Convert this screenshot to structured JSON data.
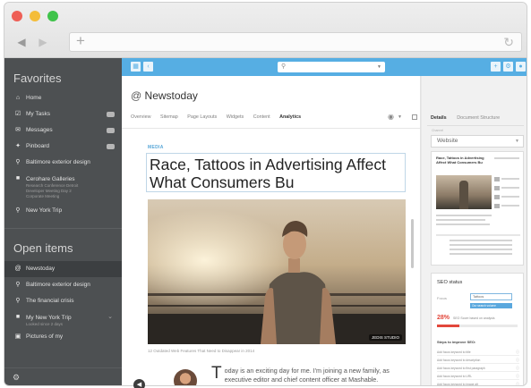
{
  "window": {
    "address_value": "",
    "colors": {
      "close": "#ee5f56",
      "minimize": "#f4bd3a",
      "maximize": "#3fc34a"
    },
    "icons": {
      "back": "arrow-left-icon",
      "forward": "arrow-right-icon",
      "new_tab": "plus-icon",
      "reload": "reload-icon"
    }
  },
  "sidebar": {
    "favorites_title": "Favorites",
    "favorites": [
      {
        "label": "Home",
        "icon": "home-icon",
        "badge": false
      },
      {
        "label": "My Tasks",
        "icon": "tasks-icon",
        "badge": true
      },
      {
        "label": "Messages",
        "icon": "messages-icon",
        "badge": true
      },
      {
        "label": "Pinboard",
        "icon": "pin-icon",
        "badge": true
      },
      {
        "label": "Baltimore exterior design",
        "icon": "search-icon",
        "badge": false
      },
      {
        "label": "Cerohare Galleries",
        "icon": "document-icon",
        "subtext": [
          "Research Conference Detroit",
          "Developer Meeting Day 2",
          "Corporate Meeting"
        ]
      },
      {
        "label": "New York Trip",
        "icon": "search-icon",
        "badge": false
      }
    ],
    "open_items_title": "Open items",
    "open_items": [
      {
        "label": "Newstoday",
        "icon": "at-icon",
        "active": true
      },
      {
        "label": "Baltimore exterior design",
        "icon": "search-icon"
      },
      {
        "label": "The financial crisis",
        "icon": "search-icon"
      },
      {
        "label": "My New York Trip",
        "icon": "document-icon",
        "subtext": [
          "Looked since 2 days"
        ],
        "chevron": true
      },
      {
        "label": "Pictures of my",
        "icon": "image-icon"
      }
    ],
    "footer_icon": "settings-icon",
    "colors": {
      "background": "#4d5052",
      "active": "#3c3f41"
    }
  },
  "appbar": {
    "search_value": "",
    "accent": "#56aee3",
    "left_icons": [
      "layout-icon",
      "back-icon"
    ],
    "right_icons": [
      "add-icon",
      "settings-icon",
      "user-icon"
    ]
  },
  "main": {
    "title_prefix": "@",
    "title": "Newstoday",
    "tabs": [
      "Overview",
      "Sitemap",
      "Page Layouts",
      "Widgets",
      "Content",
      "Analytics"
    ],
    "active_tab": "Analytics",
    "section_label": "MEDIA",
    "headline": "Race, Tattoos in Advertising Affect What Consumers Bu",
    "hero_credit": "JEDIS STUDIO",
    "caption": "12 Outdated Web Features That Need to Disappear in 2014",
    "body_dropcap": "T",
    "body_text": "oday is an exciting day for me. I'm joining a new family, as executive editor and chief content officer at Mashable."
  },
  "right_panel": {
    "tabs": [
      "Details",
      "Document Structure"
    ],
    "active_tab": "Details",
    "channel_label": "Channel",
    "channel_value": "Website",
    "preview_title": "Race, Tattoos in Advertising Affect What Consumers Bu",
    "seo": {
      "title": "SEO status",
      "focus_label": "Focus",
      "focus_value": "Tattoos",
      "focus_chip": "Our search volume",
      "score": "28%",
      "score_text": "SEO Score based on analysis",
      "score_fraction": 0.28,
      "steps_title": "Steps to improve SEO:",
      "steps": [
        "Add focus keyword to title",
        "Add focus keyword to description",
        "Add focus keyword to first paragraph",
        "Add focus keyword to URL",
        "Add focus keyword to image alt"
      ]
    }
  }
}
